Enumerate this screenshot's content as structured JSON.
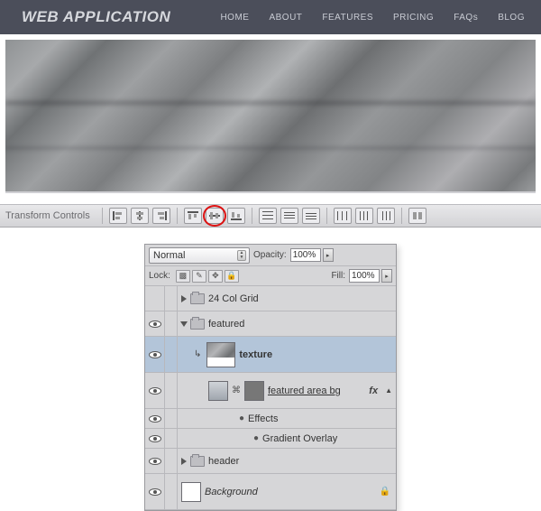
{
  "site": {
    "title": "WEB APPLICATION",
    "nav": [
      "HOME",
      "ABOUT",
      "FEATURES",
      "PRICING",
      "FAQs",
      "BLOG"
    ]
  },
  "options_bar": {
    "label": "Transform Controls"
  },
  "layers_panel": {
    "blend_mode": "Normal",
    "opacity_label": "Opacity:",
    "opacity_value": "100%",
    "lock_label": "Lock:",
    "fill_label": "Fill:",
    "fill_value": "100%",
    "layers": {
      "grid": "24 Col Grid",
      "featured": "featured",
      "texture": "texture",
      "featured_bg": "featured area bg",
      "effects": "Effects",
      "gradient_overlay": "Gradient Overlay",
      "header": "header",
      "background": "Background"
    },
    "fx": "fx"
  }
}
